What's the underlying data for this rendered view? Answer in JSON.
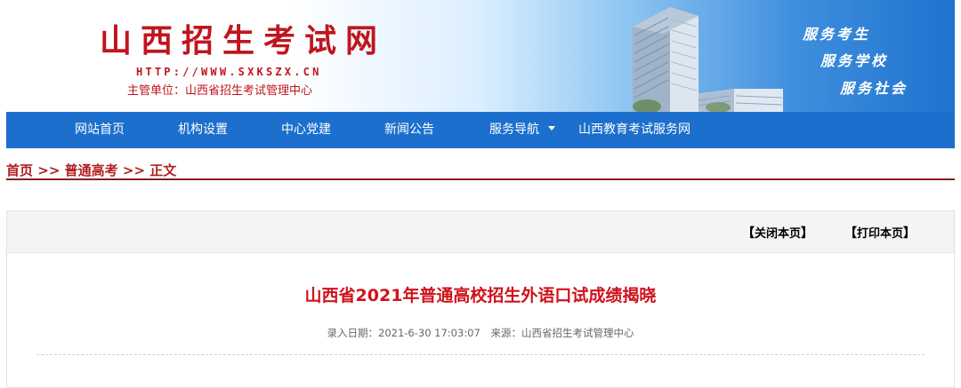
{
  "banner": {
    "title": "山西招生考试网",
    "url": "HTTP://WWW.SXKSZX.CN",
    "sponsor": "主管单位：山西省招生考试管理中心",
    "slogans": [
      "服务考生",
      "服务学校",
      "服务社会"
    ],
    "colors": {
      "title": "#c0151e",
      "sky": "#1f73cf"
    }
  },
  "nav": {
    "items": [
      "网站首页",
      "机构设置",
      "中心党建",
      "新闻公告",
      "服务导航",
      "山西教育考试服务网"
    ],
    "background": "#1c6fcd"
  },
  "breadcrumb": {
    "home": "首页",
    "sep": ">>",
    "section": "普通高考",
    "current": "正文"
  },
  "toolbar": {
    "close_label": "关闭本页",
    "print_label": "打印本页",
    "bracket_open": "【",
    "bracket_close": "】"
  },
  "article": {
    "title": "山西省2021年普通高校招生外语口试成绩揭晓",
    "date_label": "录入日期：",
    "date": "2021-6-30 17:03:07",
    "source_label": "来源：",
    "source": "山西省招生考试管理中心",
    "title_color": "#d0121b"
  }
}
